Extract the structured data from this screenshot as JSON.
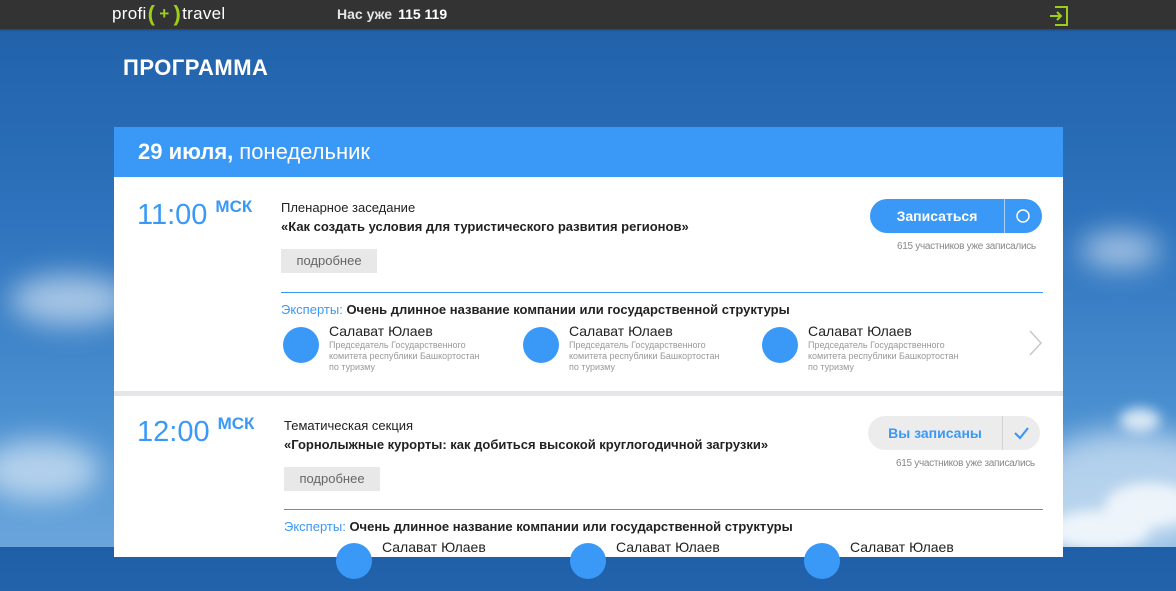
{
  "header": {
    "logo": {
      "left": "profi",
      "plus": "+",
      "right": "travel"
    },
    "count_label": "Нас уже",
    "count_value": "115 119"
  },
  "page_title": "ПРОГРАММА",
  "day": {
    "date": "29 июля,",
    "weekday": "понедельник"
  },
  "sessions": [
    {
      "time": "11:00",
      "tz": "МСК",
      "type": "Пленарное заседание",
      "title": "«Как создать условия для туристического развития регионов»",
      "more": "подробнее",
      "register_label": "Записаться",
      "register_state": "not-registered",
      "participants": "615 участников уже записались",
      "experts_label": "Эксперты:",
      "experts_value": "Очень длинное название компании или государственной структуры",
      "experts": [
        {
          "name": "Салават Юлаев",
          "desc": "Председатель Государственного комитета республики Башкортостан по туризму"
        },
        {
          "name": "Салават Юлаев",
          "desc": "Председатель Государственного комитета республики Башкортостан по туризму"
        },
        {
          "name": "Салават Юлаев",
          "desc": "Председатель Государственного комитета республики Башкортостан по туризму"
        }
      ]
    },
    {
      "time": "12:00",
      "tz": "МСК",
      "type": "Тематическая секция",
      "title": "«Горнолыжные курорты: как добиться высокой круглогодичной загрузки»",
      "more": "подробнее",
      "register_label": "Вы записаны",
      "register_state": "registered",
      "participants": "615 участников уже записались",
      "experts_label": "Эксперты:",
      "experts_value": "Очень длинное название компании или государственной структуры",
      "experts": [
        {
          "name": "Салават Юлаев"
        },
        {
          "name": "Салават Юлаев"
        },
        {
          "name": "Салават Юлаев"
        }
      ]
    }
  ],
  "colors": {
    "accent": "#3a99f7",
    "brand_green": "#9ccf1c",
    "topbar": "#333333"
  }
}
